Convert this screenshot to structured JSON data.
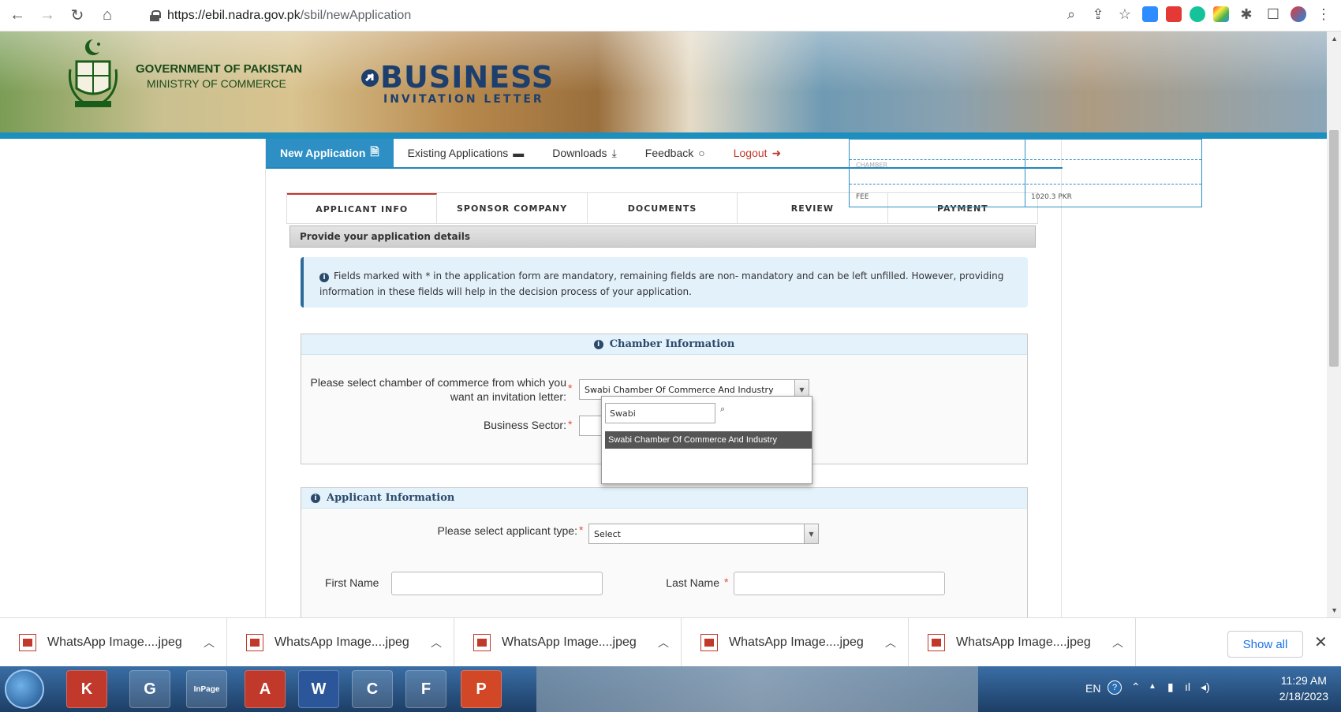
{
  "browser": {
    "url_host": "https://ebil.nadra.gov.pk",
    "url_path": "/sbil/newApplication"
  },
  "banner": {
    "gov_title": "GOVERNMENT OF PAKISTAN",
    "gov_sub": "MINISTRY OF COMMERCE",
    "biz_title": "BUSINESS",
    "biz_sub": "INVITATION LETTER"
  },
  "nav": {
    "new_application": "New Application",
    "existing_applications": "Existing Applications",
    "downloads": "Downloads",
    "feedback": "Feedback",
    "logout": "Logout"
  },
  "steps": [
    "APPLICANT INFO",
    "SPONSOR COMPANY",
    "DOCUMENTS",
    "REVIEW",
    "PAYMENT"
  ],
  "section_header": "Provide your application details",
  "info_note": "Fields marked with * in the application form are mandatory, remaining fields are non- mandatory and can be left unfilled. However, providing information in these fields will help in the decision process of your application.",
  "chamber": {
    "title": "Chamber Information",
    "label_line1": "Please select chamber of commerce from which you",
    "label_line2": "want an invitation letter:",
    "selected": "Swabi Chamber Of Commerce And Industry",
    "business_sector_label": "Business Sector:",
    "search_value": "Swabi",
    "option": "Swabi Chamber Of Commerce And Industry"
  },
  "applicant": {
    "title": "Applicant Information",
    "type_label": "Please select applicant type:",
    "type_value": "Select",
    "first_name_label": "First Name",
    "last_name_label": "Last Name"
  },
  "fee_table": {
    "chamber_label": "CHAMBER",
    "fee_label": "FEE",
    "fee_value": "1020.3 PKR"
  },
  "downloads_bar": {
    "items": [
      "WhatsApp Image....jpeg",
      "WhatsApp Image....jpeg",
      "WhatsApp Image....jpeg",
      "WhatsApp Image....jpeg",
      "WhatsApp Image....jpeg"
    ],
    "show_all": "Show all"
  },
  "taskbar": {
    "lang": "EN",
    "time": "11:29 AM",
    "date": "2/18/2023",
    "apps": [
      "K",
      "G",
      "InPage",
      "A",
      "W",
      "C",
      "F",
      "P"
    ]
  },
  "colors": {
    "accent": "#2d8fc4",
    "logout": "#c0392b",
    "required": "#e74c3c"
  }
}
